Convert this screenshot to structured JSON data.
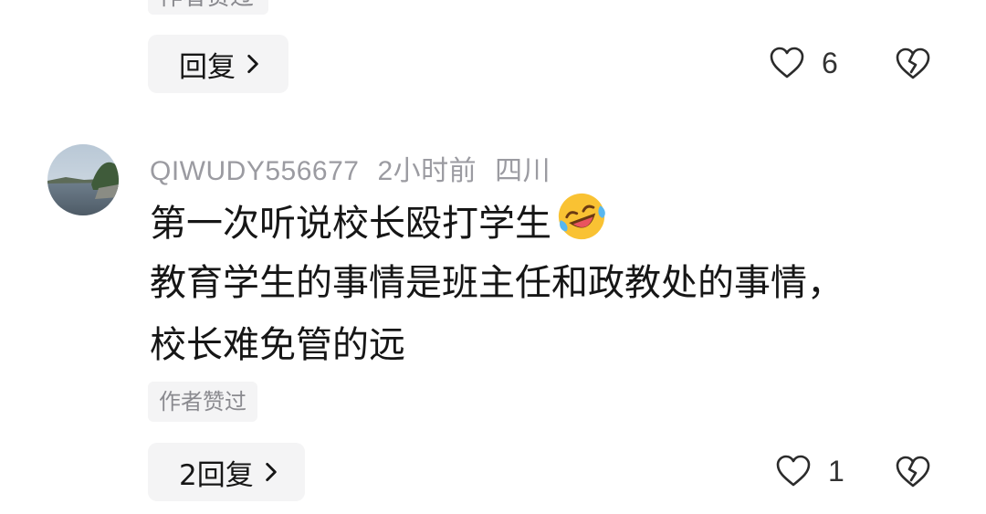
{
  "top_comment": {
    "author_tag": "作者赞过",
    "reply_label": "回复",
    "like_count": "6"
  },
  "comment": {
    "username": "QIWUDY556677",
    "time": "2小时前",
    "location": "四川",
    "text_lines": [
      "第一次听说校长殴打学生",
      "教育学生的事情是班主任和政教处的事情，",
      "校长难免管的远"
    ],
    "emoji": "laughing-crying-emoji",
    "author_tag": "作者赞过",
    "reply_label": "2回复",
    "like_count": "1"
  },
  "icons": {
    "like": "heart-outline-icon",
    "dislike": "broken-heart-icon",
    "chevron": "chevron-right-icon"
  },
  "colors": {
    "text": "#161616",
    "muted": "#9b9ba1",
    "chip_bg": "#f4f4f5"
  }
}
